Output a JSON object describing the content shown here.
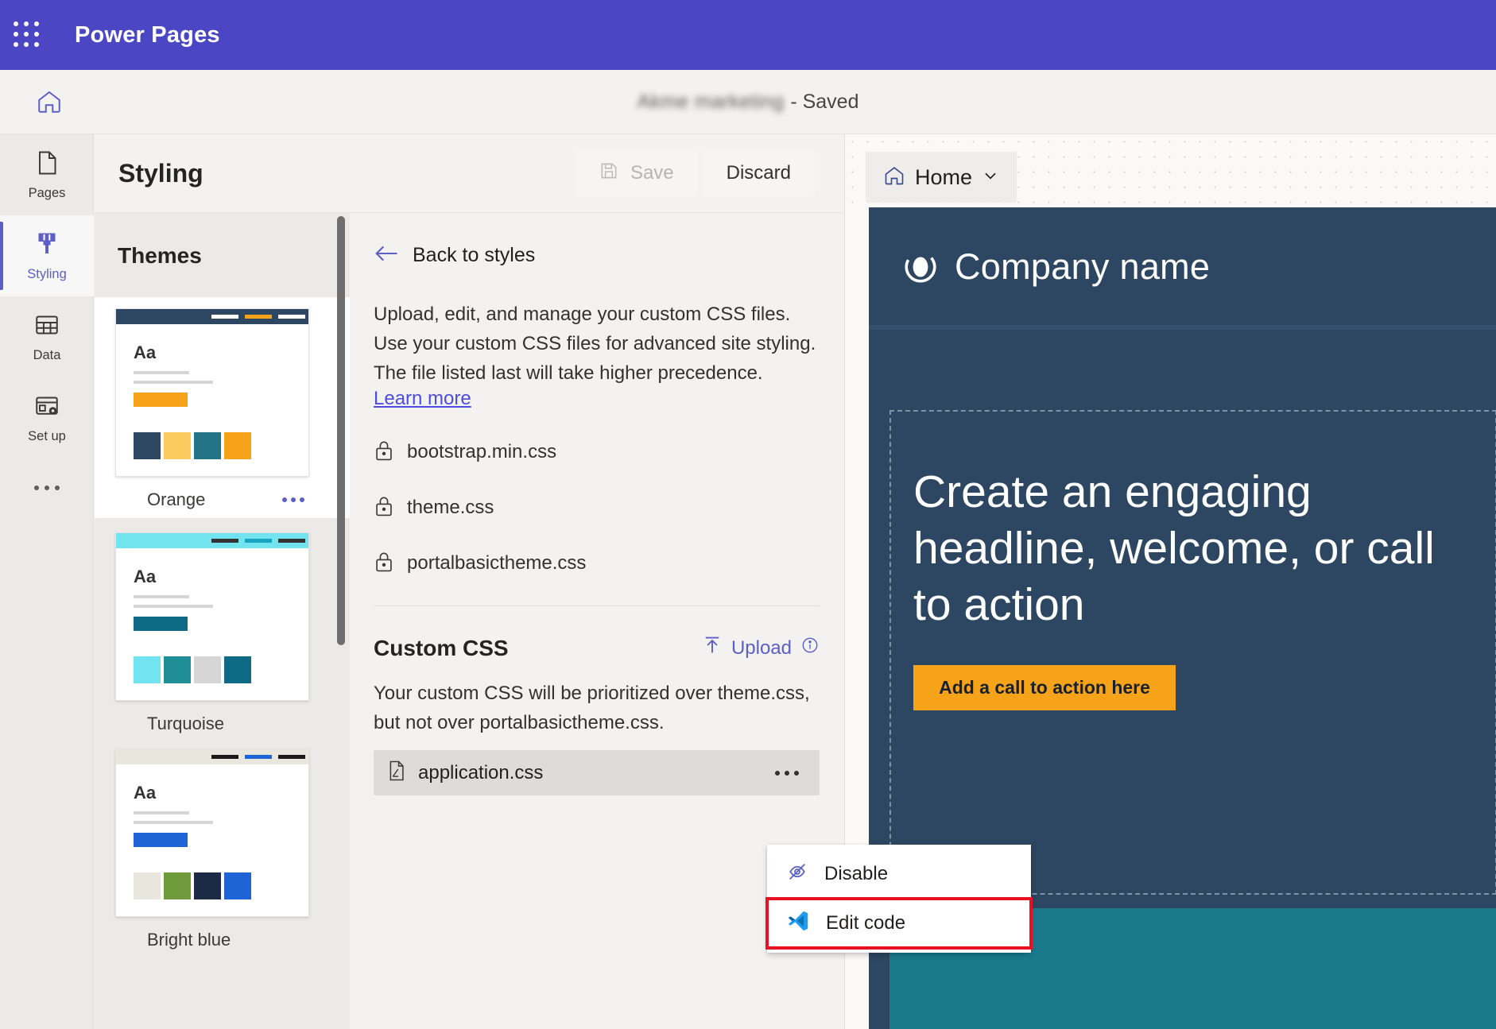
{
  "brand": {
    "title": "Power Pages",
    "waffle_icon": "app-launcher-icon",
    "bar_color": "#4b46c4"
  },
  "command_bar": {
    "home_icon": "home-icon",
    "site_name": "Akme marketing",
    "saved_status": "- Saved"
  },
  "rail": {
    "items": [
      {
        "label": "Pages",
        "icon": "page-icon",
        "active": false
      },
      {
        "label": "Styling",
        "icon": "paintbrush-icon",
        "active": true
      },
      {
        "label": "Data",
        "icon": "table-icon",
        "active": false
      },
      {
        "label": "Set up",
        "icon": "setup-gear-icon",
        "active": false
      }
    ],
    "overflow_icon": "more-ellipsis-icon"
  },
  "panel": {
    "title": "Styling",
    "save_label": "Save",
    "save_icon": "save-floppy-icon",
    "save_disabled": true,
    "discard_label": "Discard"
  },
  "themes": {
    "title": "Themes",
    "items": [
      {
        "label": "Orange",
        "selected": true,
        "bar_bg": "#2d4661",
        "bar_segments": [
          "#ffffff",
          "#f7a319",
          "#ffffff"
        ],
        "button": "#f7a319",
        "swatches": [
          "#2d4661",
          "#fbcb5f",
          "#2274869",
          "#f7a319"
        ],
        "swatch_list": [
          "#2d4661",
          "#fbcb5f",
          "#227486",
          "#f7a319"
        ],
        "aa": "Aa"
      },
      {
        "label": "Turquoise",
        "selected": false,
        "bar_bg": "#72e4f0",
        "bar_segments": [
          "#333333",
          "#19a4c0",
          "#333333"
        ],
        "button": "#0f6a86",
        "swatch_list": [
          "#72e4f0",
          "#1f8e96",
          "#d6d6d6",
          "#0f6a86"
        ],
        "aa": "Aa"
      },
      {
        "label": "Bright blue",
        "selected": false,
        "bar_bg": "#e8e6dd",
        "bar_segments": [
          "#1a1a1a",
          "#1f64d6",
          "#1a1a1a"
        ],
        "button": "#1f64d6",
        "swatch_list": [
          "#e8e6dd",
          "#6f9b3c",
          "#1d2a45",
          "#1f64d6"
        ],
        "aa": "Aa"
      }
    ]
  },
  "detail": {
    "back_label": "Back to styles",
    "back_icon": "arrow-left-icon",
    "description": "Upload, edit, and manage your custom CSS files. Use your custom CSS files for advanced site styling. The file listed last will take higher precedence.",
    "learn_more": "Learn more",
    "locked_files": [
      {
        "name": "bootstrap.min.css",
        "icon": "lock-icon"
      },
      {
        "name": "theme.css",
        "icon": "lock-icon"
      },
      {
        "name": "portalbasictheme.css",
        "icon": "lock-icon"
      }
    ],
    "custom_css_title": "Custom CSS",
    "upload_label": "Upload",
    "upload_icon": "upload-arrow-icon",
    "info_icon": "info-circle-icon",
    "custom_css_note": "Your custom CSS will be prioritized over theme.css, but not over portalbasictheme.css.",
    "custom_files": [
      {
        "name": "application.css",
        "icon": "css-file-icon",
        "more_icon": "more-ellipsis-icon",
        "selected": true
      }
    ]
  },
  "context_menu": {
    "items": [
      {
        "label": "Disable",
        "icon": "eye-slash-icon",
        "highlighted": false
      },
      {
        "label": "Edit code",
        "icon": "vscode-icon",
        "highlighted": true
      }
    ],
    "highlight_color": "#e81123"
  },
  "preview": {
    "page_tab": {
      "label": "Home",
      "home_icon": "home-icon",
      "chevron_icon": "chevron-down-icon"
    },
    "site": {
      "logo_icon": "circle-logo-icon",
      "company_name": "Company name",
      "headline": "Create an engaging headline, welcome, or call to action",
      "cta_label": "Add a call to action here",
      "cta_color": "#f7a319",
      "background": "#2d4661",
      "accent_band": "#1a7a8c"
    }
  }
}
